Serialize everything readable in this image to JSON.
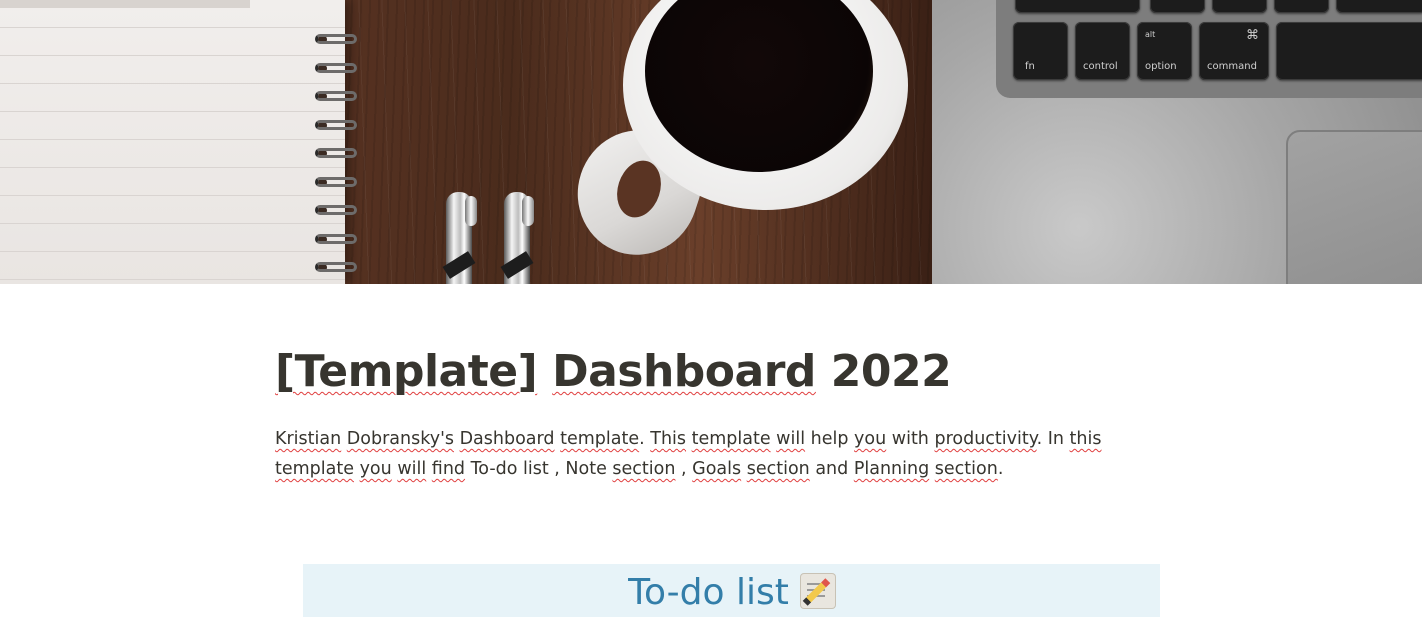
{
  "cover": {
    "keyboard_keys": [
      {
        "label": "fn"
      },
      {
        "label": "control"
      },
      {
        "sublabel": "alt",
        "label": "option"
      },
      {
        "sublabel": "⌘",
        "label": "command"
      }
    ]
  },
  "page": {
    "title_words": [
      "[Template]",
      "Dashboard",
      "2022"
    ],
    "description_tokens": [
      {
        "t": "Kristian",
        "s": true
      },
      {
        "t": " "
      },
      {
        "t": "Dobransky's",
        "s": true
      },
      {
        "t": " "
      },
      {
        "t": "Dashboard",
        "s": true
      },
      {
        "t": " "
      },
      {
        "t": "template",
        "s": true
      },
      {
        "t": ". "
      },
      {
        "t": "This",
        "s": true
      },
      {
        "t": " "
      },
      {
        "t": "template",
        "s": true
      },
      {
        "t": " "
      },
      {
        "t": "will",
        "s": true
      },
      {
        "t": " help "
      },
      {
        "t": "you",
        "s": true
      },
      {
        "t": " with "
      },
      {
        "t": "productivity",
        "s": true
      },
      {
        "t": ". In "
      },
      {
        "t": "this",
        "s": true
      },
      {
        "t": " "
      },
      {
        "t": "template",
        "s": true
      },
      {
        "t": " "
      },
      {
        "t": "you",
        "s": true
      },
      {
        "t": " "
      },
      {
        "t": "will",
        "s": true
      },
      {
        "t": " "
      },
      {
        "t": "find",
        "s": true
      },
      {
        "t": " To-do list , Note "
      },
      {
        "t": "section",
        "s": true
      },
      {
        "t": " , "
      },
      {
        "t": "Goals",
        "s": true
      },
      {
        "t": " "
      },
      {
        "t": "section",
        "s": true
      },
      {
        "t": " and "
      },
      {
        "t": "Planning",
        "s": true
      },
      {
        "t": " "
      },
      {
        "t": "section",
        "s": true
      },
      {
        "t": "."
      }
    ]
  },
  "callout": {
    "heading": "To-do list",
    "icon": "memo-icon",
    "background": "#e7f3f8",
    "text_color": "#337ea9"
  },
  "colors": {
    "text": "#37352f",
    "spellcheck_underline": "#e03e3e"
  }
}
